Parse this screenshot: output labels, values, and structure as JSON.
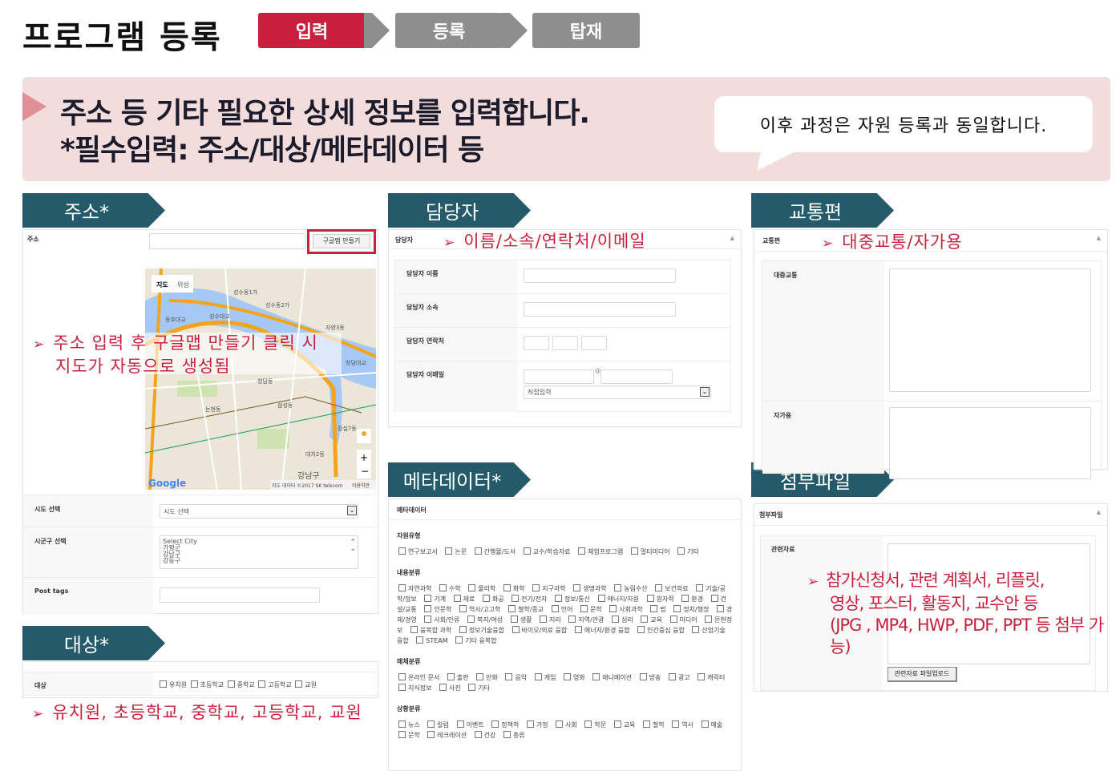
{
  "page": {
    "title": "프로그램 등록"
  },
  "steps": [
    {
      "label": "입력",
      "active": true
    },
    {
      "label": "등록",
      "active": false
    },
    {
      "label": "탑재",
      "active": false
    }
  ],
  "banner": {
    "line1": "주소 등 기타 필요한 상세 정보를 입력합니다.",
    "line2": "*필수입력: 주소/대상/메타데이터 등",
    "bubble": "이후 과정은 자원 등록과 동일합니다."
  },
  "colors": {
    "accent": "#c8203e",
    "section": "#245a69",
    "banner_bg": "#f2dcdc",
    "step_inactive": "#8e8e8e"
  },
  "sections": {
    "address": "주소*",
    "contact": "담당자",
    "traffic": "교통편",
    "target": "대상*",
    "metadata": "메타데이터*",
    "attach": "첨부파일"
  },
  "address": {
    "label": "주소",
    "button": "구글맵 만들기",
    "note1": "주소 입력 후 구글맵 만들기 클릭 시",
    "note2": "지도가 자동으로 생성됨",
    "map": {
      "tab_map": "지도",
      "tab_sat": "위성",
      "labels": [
        "성수동1가",
        "성수동2가",
        "성수대교",
        "동호대교",
        "청담대교",
        "청담동",
        "논현동",
        "삼성동",
        "강남구",
        "자양3동",
        "잠실7동",
        "대치2동"
      ],
      "copyright": "지도 데이터 ©2017 SK telecom",
      "terms": "이용약관",
      "logo": "Google"
    },
    "sido_label": "시도 선택",
    "sido_value": "시도 선택",
    "sigungu_label": "시군구 선택",
    "sigungu_options": [
      "Select City",
      "가평군",
      "강남구",
      "강동구"
    ],
    "tags_label": "Post tags"
  },
  "target": {
    "label": "대상",
    "options": [
      "유치원",
      "초등학교",
      "중학교",
      "고등학교",
      "교원"
    ],
    "note": "유치원, 초등학교, 중학교, 고등학교, 교원"
  },
  "contact": {
    "header": "담당자",
    "note": "이름/소속/연락처/이메일",
    "name": "담당자 이름",
    "org": "담당자 소속",
    "phone": "담당자 연락처",
    "email": "담당자 이메일",
    "email_select": "직접입력",
    "at": "@"
  },
  "traffic": {
    "header": "교통편",
    "note": "대중교통/자가용",
    "public": "대중교통",
    "car": "자가용"
  },
  "metadata": {
    "header": "메타데이터",
    "groups": [
      {
        "title": "자원유형",
        "items": [
          "연구보고서",
          "논문",
          "간행물/도서",
          "교수/학습자료",
          "체험프로그램",
          "멀티미디어",
          "기타"
        ]
      },
      {
        "title": "내용분류",
        "items": [
          "자연과학",
          "수학",
          "물리학",
          "화학",
          "지구과학",
          "생명과학",
          "농림수산",
          "보건의료",
          "기술/공학/정보",
          "기계",
          "재료",
          "화공",
          "전기/전자",
          "정보/통신",
          "에너지/자원",
          "원자력",
          "환경",
          "건설/교통",
          "인문학",
          "역사/고고학",
          "철학/종교",
          "언어",
          "문학",
          "사회과학",
          "법",
          "정치/행정",
          "경제/경영",
          "사회/인류",
          "복지/여성",
          "생활",
          "지리",
          "지역/관광",
          "심리",
          "교육",
          "미디어",
          "문헌정보",
          "융복합 과학",
          "정보기술융합",
          "바이오/의료 융합",
          "에너지/환경 융합",
          "인간중심 융합",
          "산업기술 융합",
          "STEAM",
          "기타 융복합"
        ]
      },
      {
        "title": "매체분류",
        "items": [
          "온라인 문서",
          "출판",
          "만화",
          "음악",
          "게임",
          "영화",
          "애니메이션",
          "방송",
          "광고",
          "캐릭터",
          "지식정보",
          "사진",
          "기타"
        ]
      },
      {
        "title": "상황분류",
        "items": [
          "뉴스",
          "칼럼",
          "이벤트",
          "정책적",
          "가정",
          "사회",
          "학문",
          "교육",
          "철학",
          "역사",
          "예술",
          "문학",
          "레크레이션",
          "건강",
          "총류"
        ]
      }
    ]
  },
  "attach": {
    "header": "첨부파일",
    "label": "관련자료",
    "button": "관련자료 파일업로드",
    "note1": "참가신청서, 관련 계획서, 리플릿,",
    "note2": "영상, 포스터, 활동지, 교수안 등",
    "note3": "(JPG , MP4, HWP, PDF, PPT 등 첨부 가능)"
  }
}
